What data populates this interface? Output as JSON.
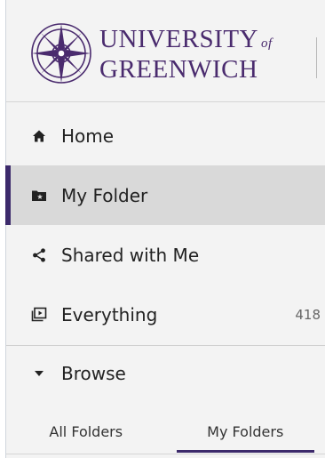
{
  "brand": {
    "name_line1": "UNIVERSITY",
    "name_of": "of",
    "name_line2": "GREENWICH",
    "color": "#4a2b6e",
    "logo_icon": "compass-rose-icon"
  },
  "nav": {
    "items": [
      {
        "label": "Home",
        "icon": "home-icon",
        "active": false
      },
      {
        "label": "My Folder",
        "icon": "folder-star-icon",
        "active": true
      },
      {
        "label": "Shared with Me",
        "icon": "share-icon",
        "active": false
      },
      {
        "label": "Everything",
        "icon": "everything-icon",
        "active": false,
        "count": "418"
      }
    ]
  },
  "browse": {
    "label": "Browse",
    "icon": "triangle-down-icon",
    "expanded": true
  },
  "tabs": [
    {
      "label": "All Folders",
      "active": false
    },
    {
      "label": "My Folders",
      "active": true
    }
  ],
  "colors": {
    "accent": "#3c2a6b",
    "sidebar_bg": "#f3f3f3",
    "active_bg": "#d9d9d9"
  }
}
